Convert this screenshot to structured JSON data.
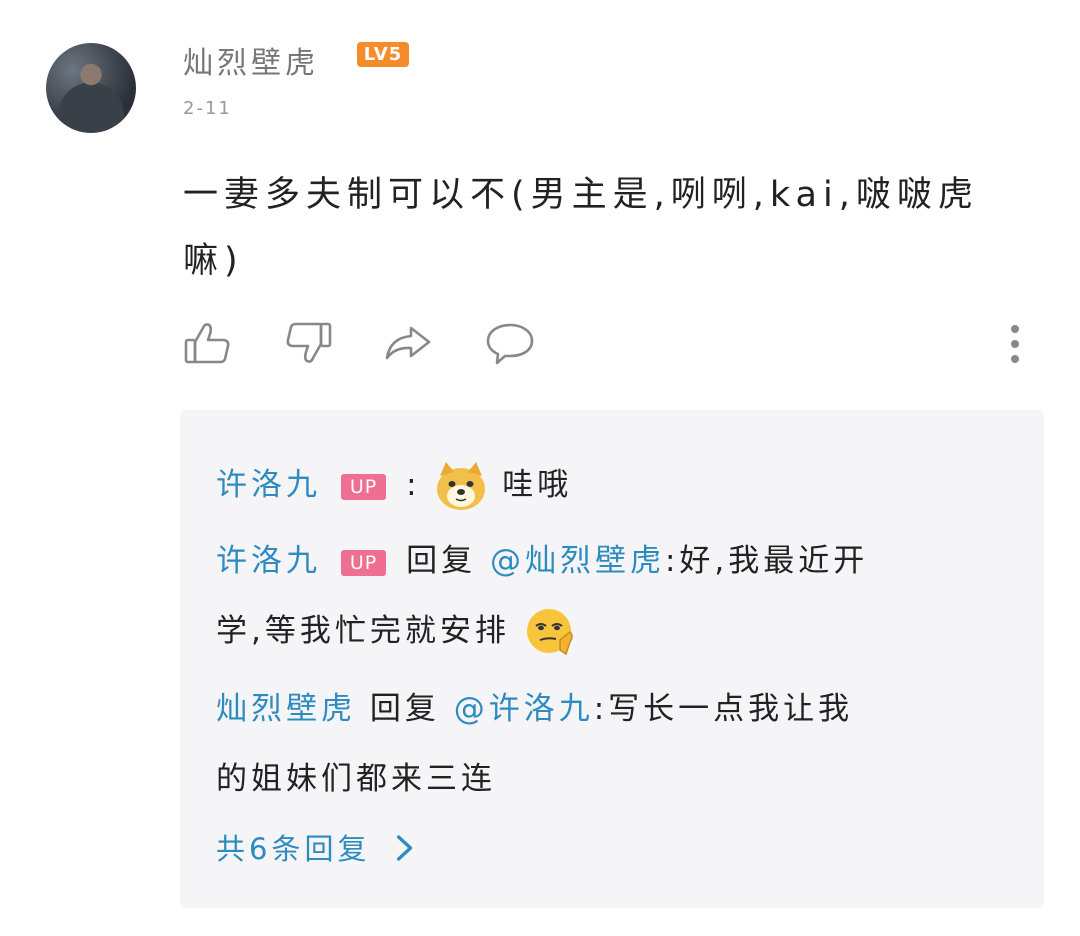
{
  "comment": {
    "username": "灿烈壁虎",
    "level": "LV5",
    "date": "2-11",
    "text_line1": "一妻多夫制可以不(男主是,咧咧,kai,啵啵虎",
    "text_line2": "嘛)"
  },
  "actions": {
    "like_icon": "thumbs-up-icon",
    "dislike_icon": "thumbs-down-icon",
    "share_icon": "share-icon",
    "reply_icon": "comment-icon",
    "more_icon": "more-vertical-icon"
  },
  "replies": [
    {
      "author": "许洛九",
      "badge": "UP",
      "separator": ":",
      "emoji": "doge-emoji",
      "text": "哇哦"
    },
    {
      "author": "许洛九",
      "badge": "UP",
      "reply_word": "回复",
      "mention": "@灿烈壁虎",
      "text_line1": ":好,我最近开",
      "text_line2": "学,等我忙完就安排",
      "emoji": "smirk-emoji"
    },
    {
      "author": "灿烈壁虎",
      "reply_word": "回复",
      "mention": "@许洛九",
      "text_line1": ":写长一点我让我",
      "text_line2": "的姐妹们都来三连"
    }
  ],
  "more_replies_label": "共6条回复",
  "colors": {
    "link_blue": "#2e8bc0",
    "up_badge": "#ef6f92",
    "level_badge": "#f68b2c"
  }
}
